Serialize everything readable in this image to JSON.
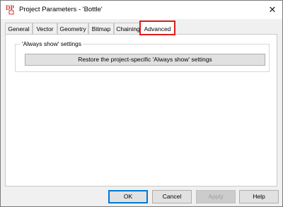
{
  "window": {
    "title": "Project Parameters - 'Bottle'",
    "app_icon": "dp-logo-icon",
    "close_icon": "close-icon",
    "close_glyph": "✕"
  },
  "tabs": [
    {
      "label": "General"
    },
    {
      "label": "Vector"
    },
    {
      "label": "Geometry"
    },
    {
      "label": "Bitmap"
    },
    {
      "label": "Chaining"
    },
    {
      "label": "Advanced",
      "active": true
    }
  ],
  "group": {
    "label": "'Always show' settings",
    "restore_label": "Restore the project-specific 'Always show' settings"
  },
  "buttons": {
    "ok": "OK",
    "cancel": "Cancel",
    "apply": "Apply",
    "help": "Help"
  },
  "colors": {
    "highlight_box": "#e01b1b",
    "default_button_border": "#0078d7",
    "logo": "#d2352b"
  }
}
